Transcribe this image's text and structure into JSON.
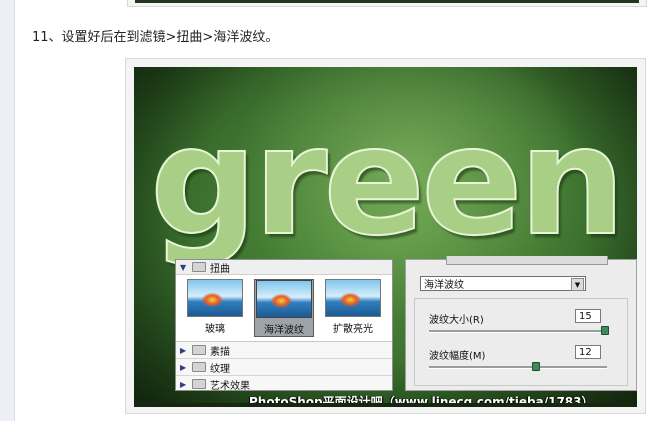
{
  "step": {
    "text": "11、设置好后在到滤镜>扭曲>海洋波纹。"
  },
  "image": {
    "word": "green",
    "watermark": "PhotoShop平面设计吧（www.linecg.com/tieba/1783）",
    "filter_gallery": {
      "category": "扭曲",
      "thumbnails": [
        {
          "label": "玻璃",
          "selected": false
        },
        {
          "label": "海洋波纹",
          "selected": true
        },
        {
          "label": "扩散亮光",
          "selected": false
        }
      ],
      "groups": [
        "素描",
        "纹理",
        "艺术效果"
      ],
      "filter_select": "海洋波纹",
      "params": [
        {
          "label": "波纹大小(R)",
          "value": "15",
          "max": 15
        },
        {
          "label": "波纹幅度(M)",
          "value": "12",
          "max": 20
        }
      ]
    }
  },
  "icons": {
    "expand": "triangle-right-icon",
    "collapse": "triangle-down-icon",
    "folder": "folder-icon",
    "dropdown": "chevron-down-icon"
  },
  "colors": {
    "background_green": "#3f7a31",
    "text_green": "#a9cf86",
    "slider_knob": "#3d8b5a"
  }
}
